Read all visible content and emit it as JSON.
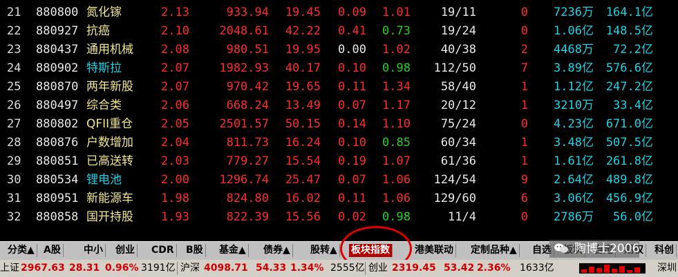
{
  "rows": [
    {
      "idx": "21",
      "code": "880800",
      "name": "氮化镓",
      "chg": "2.13",
      "price": "933.94",
      "a": "19.45",
      "b": "0.09",
      "c": "1.01",
      "ratio": "19/11",
      "d": "0",
      "vol": "7236万",
      "cap": "164.1亿",
      "name_color": "#f0e68c",
      "b_color": "#ff2a2a",
      "c_color": "#ff2a2a"
    },
    {
      "idx": "22",
      "code": "880927",
      "name": "抗癌",
      "chg": "2.10",
      "price": "2048.61",
      "a": "42.22",
      "b": "0.41",
      "c": "0.73",
      "ratio": "19/24",
      "d": "0",
      "vol": "1.06亿",
      "cap": "148.5亿",
      "name_color": "#f0e68c",
      "b_color": "#ff2a2a",
      "c_color": "#22d022"
    },
    {
      "idx": "23",
      "code": "880437",
      "name": "通用机械",
      "chg": "2.08",
      "price": "980.51",
      "a": "19.95",
      "b": "0.00",
      "c": "1.02",
      "ratio": "40/38",
      "d": "2",
      "vol": "4468万",
      "cap": "72.2亿",
      "name_color": "#f0e68c",
      "b_color": "#e8e8e8",
      "c_color": "#ff2a2a"
    },
    {
      "idx": "24",
      "code": "880902",
      "name": "特斯拉",
      "chg": "2.07",
      "price": "1982.93",
      "a": "40.17",
      "b": "0.10",
      "c": "0.98",
      "ratio": "112/50",
      "d": "7",
      "vol": "3.89亿",
      "cap": "576.6亿",
      "name_color": "#18d4e6",
      "b_color": "#ff2a2a",
      "c_color": "#22d022"
    },
    {
      "idx": "25",
      "code": "880870",
      "name": "两年新股",
      "chg": "2.07",
      "price": "970.42",
      "a": "19.65",
      "b": "0.11",
      "c": "1.34",
      "ratio": "58/40",
      "d": "1",
      "vol": "1.12亿",
      "cap": "247.2亿",
      "name_color": "#f0e68c",
      "b_color": "#ff2a2a",
      "c_color": "#ff2a2a"
    },
    {
      "idx": "26",
      "code": "880497",
      "name": "综合类",
      "chg": "2.06",
      "price": "668.24",
      "a": "13.49",
      "b": "0.07",
      "c": "1.17",
      "ratio": "20/12",
      "d": "1",
      "vol": "3210万",
      "cap": "33.4亿",
      "name_color": "#f0e68c",
      "b_color": "#ff2a2a",
      "c_color": "#ff2a2a"
    },
    {
      "idx": "27",
      "code": "880802",
      "name": "QFII重仓",
      "chg": "2.05",
      "price": "2501.57",
      "a": "50.15",
      "b": "0.14",
      "c": "1.10",
      "ratio": "75/24",
      "d": "0",
      "vol": "4.23亿",
      "cap": "671.0亿",
      "name_color": "#f0e68c",
      "b_color": "#ff2a2a",
      "c_color": "#ff2a2a"
    },
    {
      "idx": "28",
      "code": "880876",
      "name": "户数增加",
      "chg": "2.04",
      "price": "811.73",
      "a": "16.24",
      "b": "0.10",
      "c": "0.85",
      "ratio": "60/34",
      "d": "1",
      "vol": "3.48亿",
      "cap": "507.5亿",
      "name_color": "#f0e68c",
      "b_color": "#ff2a2a",
      "c_color": "#22d022"
    },
    {
      "idx": "29",
      "code": "880851",
      "name": "已高送转",
      "chg": "2.03",
      "price": "779.27",
      "a": "15.54",
      "b": "0.19",
      "c": "1.07",
      "ratio": "61/36",
      "d": "1",
      "vol": "1.61亿",
      "cap": "261.8亿",
      "name_color": "#f0e68c",
      "b_color": "#ff2a2a",
      "c_color": "#ff2a2a"
    },
    {
      "idx": "30",
      "code": "880534",
      "name": "锂电池",
      "chg": "2.00",
      "price": "1296.74",
      "a": "25.47",
      "b": "0.07",
      "c": "1.06",
      "ratio": "124/54",
      "d": "9",
      "vol": "2.64亿",
      "cap": "489.8亿",
      "name_color": "#18d4e6",
      "b_color": "#ff2a2a",
      "c_color": "#ff2a2a"
    },
    {
      "idx": "31",
      "code": "880951",
      "name": "新能源车",
      "chg": "1.98",
      "price": "824.80",
      "a": "16.02",
      "b": "0.11",
      "c": "1.06",
      "ratio": "129/60",
      "d": "6",
      "vol": "3.06亿",
      "cap": "456.9亿",
      "name_color": "#f0e68c",
      "b_color": "#ff2a2a",
      "c_color": "#ff2a2a"
    },
    {
      "idx": "32",
      "code": "880858",
      "name": "国开持股",
      "chg": "1.93",
      "price": "822.39",
      "a": "15.56",
      "b": "0.02",
      "c": "0.98",
      "ratio": "11/4",
      "d": "0",
      "vol": "2786万",
      "cap": "56.0亿",
      "name_color": "#f0e68c",
      "b_color": "#ff2a2a",
      "c_color": "#22d022"
    }
  ],
  "tabs": [
    "分类▲",
    "A股",
    "中小",
    "创业",
    "CDR",
    "B股",
    "基金▲",
    "债券▲",
    "股转▲",
    "板块指数",
    "港美联动",
    "定制品种▲",
    "自选",
    "板块",
    "自定",
    "期权",
    "科创"
  ],
  "active_tab": "板块指数",
  "watermark": "陶博士2006",
  "status": {
    "sh_label": "上证",
    "sh_value": "2967.63",
    "sh_chg": "28.31",
    "sh_pct": "0.96%",
    "sh_amt": "3191亿",
    "hs_label": "沪深",
    "hs_value": "4098.71",
    "hs_chg": "54.33",
    "hs_pct": "1.34%",
    "hs_amt": "2555亿",
    "cy_label": "创业",
    "cy_value": "2319.45",
    "cy_chg": "53.42",
    "cy_pct": "2.36%",
    "cy_amt": "1633亿",
    "sz_label": "深圳"
  },
  "colors": {
    "up": "#ff2a2a",
    "down": "#22d022",
    "cyan": "#18d4e6",
    "highlight_circle": "#e00000"
  }
}
